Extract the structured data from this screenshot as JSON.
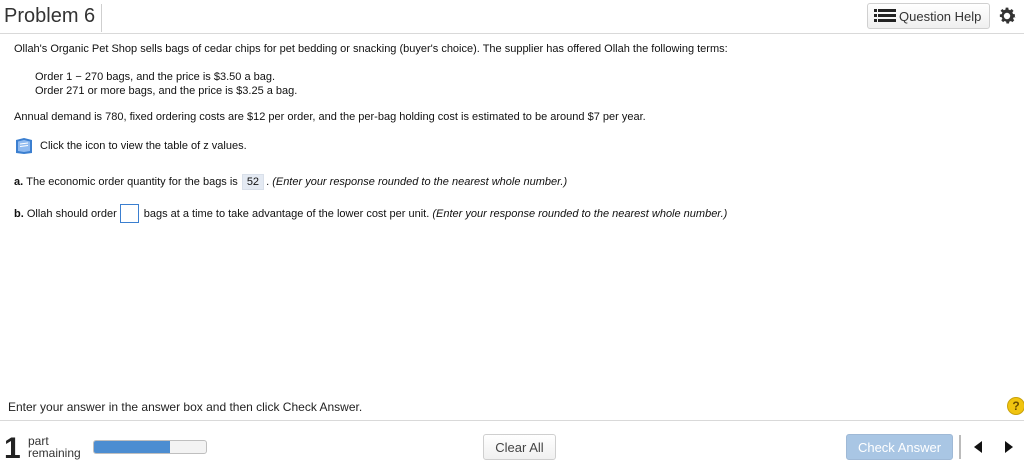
{
  "header": {
    "title": "Problem 6",
    "question_help_label": "Question Help",
    "list_icon": "list-icon",
    "settings_icon": "gear-icon"
  },
  "problem": {
    "intro": "Ollah's Organic Pet Shop sells bags of cedar chips for pet bedding or snacking (buyer's choice). The supplier has offered Ollah the following terms:",
    "terms": [
      "Order 1 − 270 bags, and the price is $3.50 a bag.",
      "Order 271 or more bags, and the price is $3.25 a bag."
    ],
    "annual": "Annual demand is 780, fixed ordering costs are $12 per order, and the per-bag holding cost is estimated to be around $7 per year.",
    "book_text": "Click the icon to view the table of z values.",
    "book_icon": "book-icon"
  },
  "part_a": {
    "label": "a.",
    "text": "The economic order quantity for the bags is",
    "answer": "52",
    "after": ".",
    "hint": "(Enter your response rounded to the nearest whole number.)"
  },
  "part_b": {
    "label": "b.",
    "text": "Ollah should order",
    "answer": "",
    "after": "bags at a time to take advantage of the lower cost per unit.",
    "hint": "(Enter your response rounded to the nearest whole number.)"
  },
  "instruction": "Enter your answer in the answer box and then click Check Answer.",
  "help_symbol": "?",
  "footer": {
    "parts_remaining_number": "1",
    "part_label": "part",
    "remaining_label": "remaining",
    "progress_fraction": 0.68,
    "clear_all_label": "Clear All",
    "check_answer_label": "Check Answer",
    "prev_icon": "triangle-left-icon",
    "next_icon": "triangle-right-icon"
  },
  "colors": {
    "accent_blue": "#4c8dd1",
    "check_button_disabled": "#a9c6e4",
    "answer_highlight": "#e4eaf3",
    "help_yellow": "#f1c40f"
  }
}
